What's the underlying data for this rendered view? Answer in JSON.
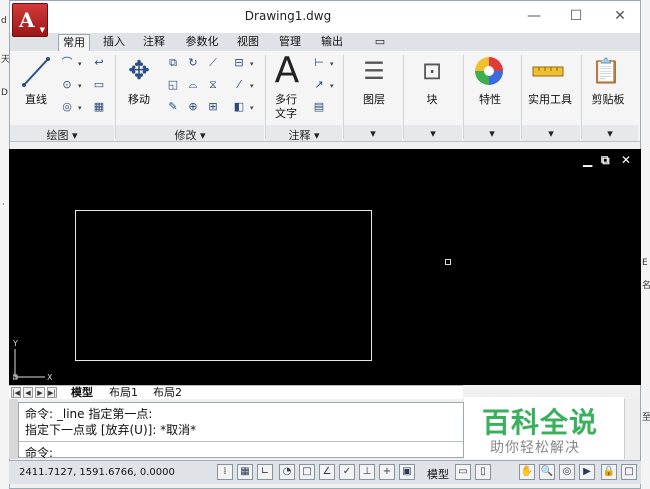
{
  "window": {
    "title": "Drawing1.dwg",
    "minimize": "—",
    "maximize": "☐",
    "close": "✕"
  },
  "app_button": {
    "logo": "A",
    "arrow": "▼"
  },
  "outside": {
    "left_chars": [
      "d",
      "天",
      "D",
      "·"
    ],
    "right_chars": [
      "E",
      "名",
      "至"
    ]
  },
  "tabs": [
    {
      "label": "常用",
      "active": true
    },
    {
      "label": "插入"
    },
    {
      "label": "注释"
    },
    {
      "label": "参数化"
    },
    {
      "label": "视图"
    },
    {
      "label": "管理"
    },
    {
      "label": "输出"
    },
    {
      "label": "▭"
    }
  ],
  "ribbon": {
    "panels": [
      {
        "title": "绘图 ▾"
      },
      {
        "title": "修改 ▾"
      },
      {
        "title": "注释 ▾"
      },
      {
        "title": "▾"
      },
      {
        "title": "▾"
      },
      {
        "title": "▾"
      },
      {
        "title": "▾"
      },
      {
        "title": "▾"
      }
    ],
    "big_buttons": {
      "line": "直线",
      "move": "移动",
      "mtext_1": "多行",
      "mtext_2": "文字",
      "layer": "图层",
      "block": "块",
      "properties": "特性",
      "utilities": "实用工具",
      "clipboard": "剪贴板"
    },
    "mtext_letter": "A"
  },
  "viewport": {
    "minimize": "▁",
    "restore": "⧉",
    "close": "✕",
    "ucs_y": "Y",
    "ucs_x": "X"
  },
  "layout_tabs": {
    "model": "模型",
    "layout1": "布局1",
    "layout2": "布局2"
  },
  "command": {
    "history_1": "命令: _line 指定第一点:",
    "history_2": "指定下一点或 [放弃(U)]: *取消*",
    "prompt": "命令:"
  },
  "watermark": {
    "title": "百科全说",
    "subtitle": "助你轻松解决"
  },
  "status": {
    "coords": "2411.7127, 1591.6766, 0.0000",
    "model": "模型"
  },
  "colors": {
    "accent_red": "#c62828",
    "watermark_green": "#3ab05d",
    "canvas": "#000000"
  }
}
